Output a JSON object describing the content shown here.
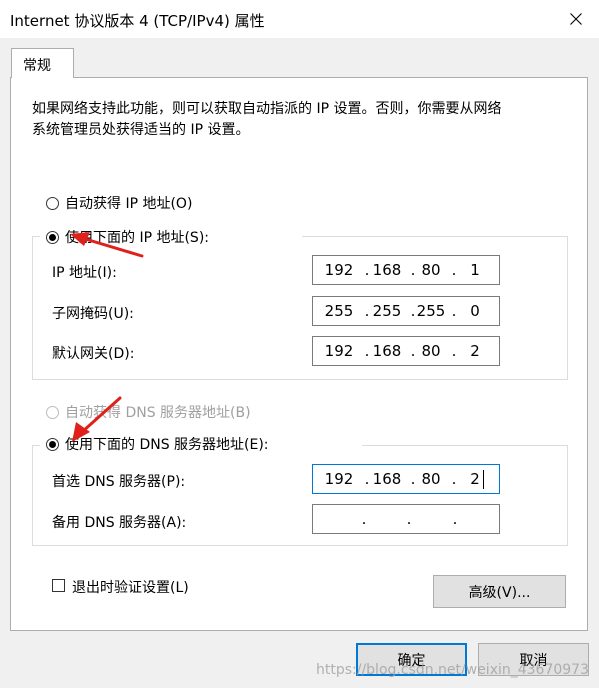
{
  "window": {
    "title": "Internet 协议版本 4 (TCP/IPv4) 属性"
  },
  "tabs": [
    {
      "label": "常规"
    }
  ],
  "description": [
    "如果网络支持此功能，则可以获取自动指派的 IP 设置。否则，你需要从网络",
    "系统管理员处获得适当的 IP 设置。"
  ],
  "ip_section": {
    "auto_label": "自动获得 IP 地址(O)",
    "manual_label": "使用下面的 IP 地址(S):",
    "selected": "manual",
    "fields": [
      {
        "label": "IP 地址(I):",
        "octets": [
          "192",
          "168",
          "80",
          "1"
        ]
      },
      {
        "label": "子网掩码(U):",
        "octets": [
          "255",
          "255",
          "255",
          "0"
        ]
      },
      {
        "label": "默认网关(D):",
        "octets": [
          "192",
          "168",
          "80",
          "2"
        ]
      }
    ]
  },
  "dns_section": {
    "auto_label": "自动获得 DNS 服务器地址(B)",
    "manual_label": "使用下面的 DNS 服务器地址(E):",
    "selected": "manual",
    "fields": [
      {
        "label": "首选 DNS 服务器(P):",
        "octets": [
          "192",
          "168",
          "80",
          "2"
        ]
      },
      {
        "label": "备用 DNS 服务器(A):",
        "octets": [
          "",
          "",
          "",
          ""
        ]
      }
    ]
  },
  "validate_label": "退出时验证设置(L)",
  "buttons": {
    "advanced": "高级(V)...",
    "ok": "确定",
    "cancel": "取消"
  },
  "watermark": "https://blog.csdn.net/weixin_43670973",
  "colors": {
    "annotation_arrow": "#e0201b",
    "focus_border": "#0078d7"
  },
  "icons": {
    "close": "close-icon",
    "annotation": "red-arrow-icon"
  }
}
